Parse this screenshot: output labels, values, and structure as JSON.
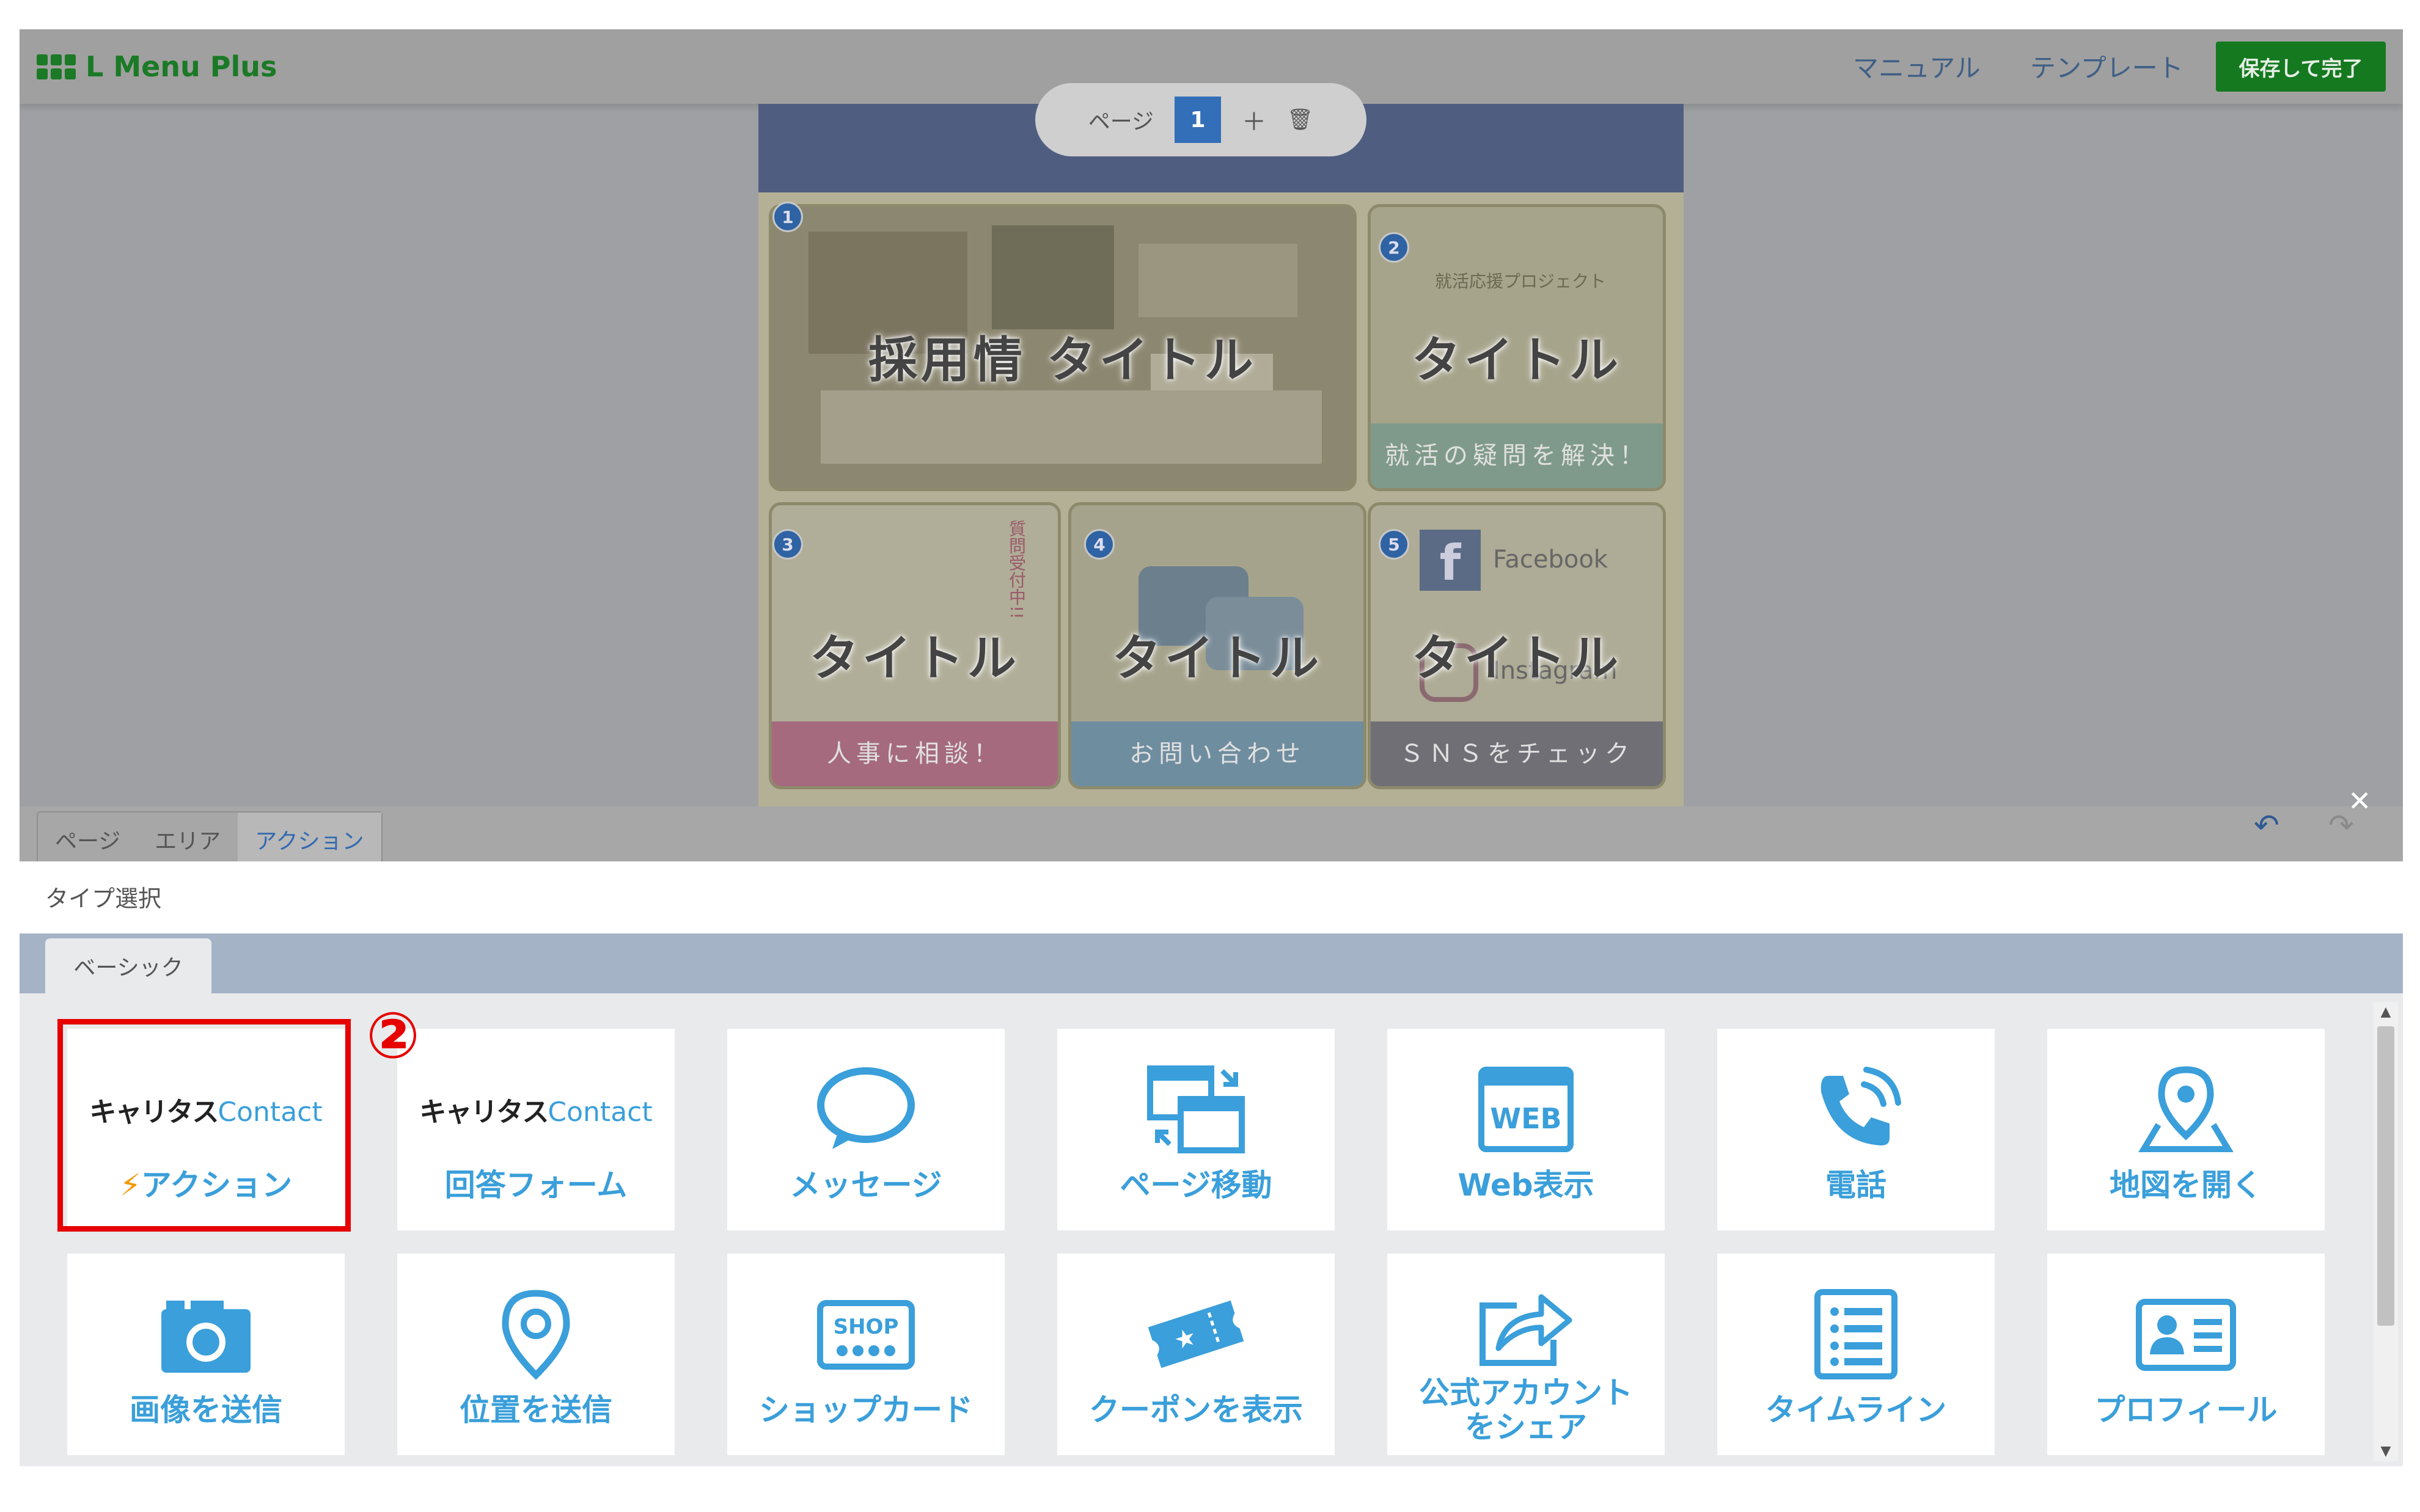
{
  "header": {
    "logo_text": "L Menu Plus",
    "links": [
      "マニュアル",
      "テンプレート"
    ],
    "save_label": "保存して完了"
  },
  "pager": {
    "label": "ページ",
    "current": "1",
    "add_icon": "plus-icon",
    "delete_icon": "trash-icon"
  },
  "tiles": [
    {
      "num": "1",
      "title": "採用情 タイトル",
      "band": ""
    },
    {
      "num": "2",
      "title": "タイトル",
      "band": "就活の疑問を解決！",
      "overlay": "就活応援プロジェクト"
    },
    {
      "num": "3",
      "title": "タイトル",
      "band": "人事に相談！",
      "overlay": "質問受付中!!"
    },
    {
      "num": "4",
      "title": "タイトル",
      "band": "お問い合わせ"
    },
    {
      "num": "5",
      "title": "タイトル",
      "band": "ＳＮＳをチェック",
      "overlay": "Facebook",
      "overlay2": "Instagram"
    }
  ],
  "editor_tabs": [
    "ページ",
    "エリア",
    "アクション"
  ],
  "active_editor_tab": "アクション",
  "type_select_label": "タイプ選択",
  "panel_tab": "ベーシック",
  "step_marker": "②",
  "cards": [
    {
      "label": "アクション",
      "icon": "career-contact-logo",
      "logo_main": "キャリタス",
      "logo_sub": "Contact"
    },
    {
      "label": "回答フォーム",
      "icon": "career-contact-logo",
      "logo_main": "キャリタス",
      "logo_sub": "Contact"
    },
    {
      "label": "メッセージ",
      "icon": "speech-bubble-icon"
    },
    {
      "label": "ページ移動",
      "icon": "page-switch-icon"
    },
    {
      "label": "Web表示",
      "icon": "web-icon",
      "icon_text": "WEB"
    },
    {
      "label": "電話",
      "icon": "phone-icon"
    },
    {
      "label": "地図を開く",
      "icon": "map-pin-icon"
    },
    {
      "label": "画像を送信",
      "icon": "camera-icon"
    },
    {
      "label": "位置を送信",
      "icon": "location-icon"
    },
    {
      "label": "ショップカード",
      "icon": "shop-card-icon",
      "icon_text": "SHOP"
    },
    {
      "label": "クーポンを表示",
      "icon": "coupon-icon"
    },
    {
      "label": "公式アカウント\nをシェア",
      "icon": "share-icon"
    },
    {
      "label": "タイムライン",
      "icon": "timeline-icon"
    },
    {
      "label": "プロフィール",
      "icon": "profile-icon"
    }
  ],
  "colors": {
    "brand_green": "#1a7a26",
    "accent_blue": "#3a9fda",
    "highlight_red": "#e60000"
  }
}
